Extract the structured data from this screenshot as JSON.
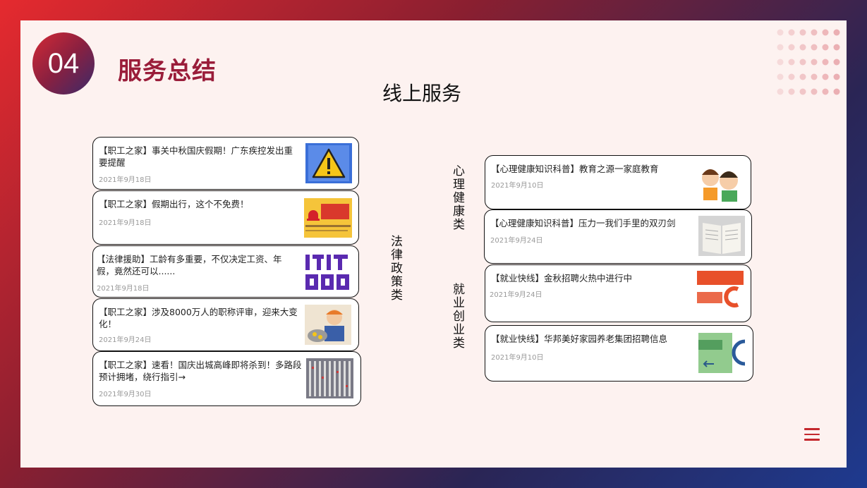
{
  "header": {
    "section_number": "04",
    "title": "服务总结",
    "subtitle": "线上服务"
  },
  "categories": {
    "law": "法律政策类",
    "mental": "心理健康类",
    "employment": "就业创业类"
  },
  "left_cards": [
    {
      "title": "【职工之家】事关中秋国庆假期！广东疾控发出重要提醒",
      "date": "2021年9月18日",
      "thumb": "warning-icon"
    },
    {
      "title": "【职工之家】假期出行，这个不免费！",
      "date": "2021年9月18日",
      "thumb": "alert-banner"
    },
    {
      "title": "【法律援助】工龄有多重要，不仅决定工资、年假，竟然还可以......",
      "date": "2021年9月18日",
      "thumb": "law-banner"
    },
    {
      "title": "【职工之家】涉及8000万人的职称评审，迎来大变化！",
      "date": "2021年9月24日",
      "thumb": "cartoon-worker"
    },
    {
      "title": "【职工之家】速看！国庆出城高峰即将杀到！多路段预计拥堵，绕行指引→",
      "date": "2021年9月30日",
      "thumb": "traffic-photo"
    }
  ],
  "right_cards": [
    {
      "title": "【心理健康知识科普】教育之源一家庭教育",
      "date": "2021年9月10日",
      "thumb": "family-cartoon"
    },
    {
      "title": "【心理健康知识科普】压力一我们手里的双刃剑",
      "date": "2021年9月24日",
      "thumb": "book-photo"
    },
    {
      "title": "【就业快线】金秋招聘火热中进行中",
      "date": "2021年9月24日",
      "thumb": "recruit-banner"
    },
    {
      "title": "【就业快线】华邦美好家园养老集团招聘信息",
      "date": "2021年9月10日",
      "thumb": "green-banner"
    }
  ],
  "colors": {
    "accent": "#c4282d",
    "title": "#9a1d3a",
    "slide_bg": "#fdf2f0"
  },
  "icons": {
    "menu": "hamburger-menu-icon"
  }
}
